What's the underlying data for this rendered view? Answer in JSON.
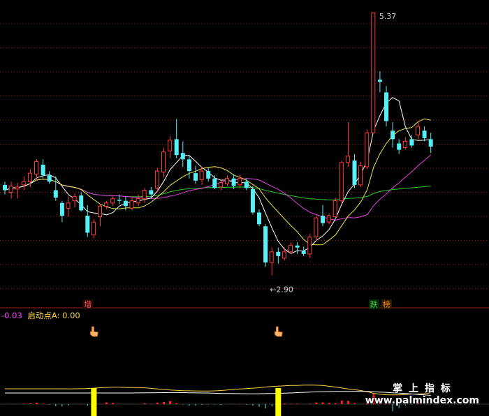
{
  "chart_data": {
    "type": "candlestick",
    "main": {
      "price_range": [
        2.6,
        5.45
      ],
      "high_label": "5.37",
      "high_price": 5.37,
      "low_label": "←2.90",
      "low_price": 2.9,
      "candles": [
        [
          3.75,
          3.7,
          3.78,
          3.66
        ],
        [
          3.68,
          3.74,
          3.78,
          3.62
        ],
        [
          3.71,
          3.73,
          3.77,
          3.62
        ],
        [
          3.75,
          3.78,
          3.83,
          3.7
        ],
        [
          3.78,
          3.86,
          3.9,
          3.73
        ],
        [
          3.85,
          3.97,
          3.99,
          3.79
        ],
        [
          3.94,
          3.84,
          3.99,
          3.81
        ],
        [
          3.84,
          3.78,
          3.88,
          3.76
        ],
        [
          3.7,
          3.63,
          3.83,
          3.6
        ],
        [
          3.58,
          3.46,
          3.6,
          3.4
        ],
        [
          3.53,
          3.58,
          3.64,
          3.45
        ],
        [
          3.6,
          3.64,
          3.67,
          3.54
        ],
        [
          3.65,
          3.51,
          3.68,
          3.5
        ],
        [
          3.46,
          3.3,
          3.56,
          3.26
        ],
        [
          3.28,
          3.4,
          3.43,
          3.25
        ],
        [
          3.45,
          3.55,
          3.57,
          3.36
        ],
        [
          3.55,
          3.58,
          3.6,
          3.52
        ],
        [
          3.58,
          3.62,
          3.65,
          3.55
        ],
        [
          3.61,
          3.6,
          3.66,
          3.57
        ],
        [
          3.6,
          3.55,
          3.64,
          3.51
        ],
        [
          3.53,
          3.6,
          3.63,
          3.51
        ],
        [
          3.58,
          3.62,
          3.66,
          3.55
        ],
        [
          3.62,
          3.7,
          3.72,
          3.58
        ],
        [
          3.7,
          3.66,
          3.73,
          3.62
        ],
        [
          3.72,
          3.88,
          3.91,
          3.68
        ],
        [
          3.87,
          4.06,
          4.1,
          3.82
        ],
        [
          4.07,
          4.17,
          4.21,
          4.0
        ],
        [
          4.18,
          4.03,
          4.37,
          4.0
        ],
        [
          4.05,
          3.99,
          4.16,
          3.92
        ],
        [
          3.99,
          3.88,
          4.02,
          3.81
        ],
        [
          3.86,
          3.79,
          3.93,
          3.76
        ],
        [
          3.8,
          3.88,
          3.92,
          3.75
        ],
        [
          3.88,
          3.81,
          3.91,
          3.78
        ],
        [
          3.81,
          3.72,
          3.84,
          3.71
        ],
        [
          3.73,
          3.77,
          3.81,
          3.7
        ],
        [
          3.76,
          3.81,
          3.84,
          3.74
        ],
        [
          3.81,
          3.74,
          3.85,
          3.71
        ],
        [
          3.75,
          3.81,
          3.84,
          3.72
        ],
        [
          3.78,
          3.72,
          3.81,
          3.7
        ],
        [
          3.71,
          3.49,
          3.74,
          3.47
        ],
        [
          3.49,
          3.38,
          3.52,
          3.36
        ],
        [
          3.36,
          3.02,
          3.38,
          2.98
        ],
        [
          3.02,
          3.12,
          3.16,
          2.9
        ],
        [
          3.12,
          3.08,
          3.16,
          3.01
        ],
        [
          3.06,
          3.12,
          3.16,
          3.04
        ],
        [
          3.12,
          3.18,
          3.21,
          3.1
        ],
        [
          3.18,
          3.16,
          3.21,
          3.1
        ],
        [
          3.13,
          3.1,
          3.17,
          3.08
        ],
        [
          3.1,
          3.26,
          3.29,
          3.06
        ],
        [
          3.26,
          3.44,
          3.47,
          3.22
        ],
        [
          3.46,
          3.39,
          3.56,
          3.36
        ],
        [
          3.4,
          3.46,
          3.48,
          3.38
        ],
        [
          3.45,
          3.6,
          3.63,
          3.43
        ],
        [
          3.6,
          3.96,
          3.98,
          3.58
        ],
        [
          3.96,
          4.02,
          4.34,
          3.92
        ],
        [
          3.98,
          3.75,
          4.04,
          3.72
        ],
        [
          3.75,
          3.93,
          3.97,
          3.73
        ],
        [
          3.92,
          4.24,
          4.27,
          3.9
        ],
        [
          4.24,
          5.37,
          5.37,
          4.55
        ],
        [
          4.74,
          4.72,
          4.82,
          4.62
        ],
        [
          4.62,
          4.35,
          4.68,
          4.3
        ],
        [
          4.26,
          4.18,
          4.34,
          4.1
        ],
        [
          4.14,
          4.08,
          4.18,
          4.04
        ],
        [
          4.1,
          4.16,
          4.2,
          4.08
        ],
        [
          4.18,
          4.12,
          4.22,
          4.1
        ],
        [
          4.22,
          4.3,
          4.35,
          4.18
        ],
        [
          4.26,
          4.19,
          4.3,
          4.16
        ],
        [
          4.18,
          4.11,
          4.24,
          4.05
        ]
      ],
      "ma_colors": {
        "ma5": "#ffffff",
        "ma10": "#e8e84a",
        "ma20": "#e040e0",
        "ma60": "#2ec82e"
      },
      "markers": [
        {
          "text": "增",
          "color": "#ff5a5a",
          "bg": "#2a0808",
          "index": 13
        },
        {
          "text": "跌",
          "color": "#3ccf3c",
          "bg": "#0a2a0a",
          "index": 58
        },
        {
          "text": "榜",
          "color": "#ff8c1a",
          "bg": "#2a1800",
          "index": 60
        }
      ]
    },
    "indicator": {
      "left_value": "-0.03",
      "series_label": "启动点A:",
      "series_value": "0.00",
      "label_color": "#ffd24a",
      "value_color": "#ff40ff",
      "signal_indices": [
        14,
        43
      ],
      "signal_color": "#ffff00",
      "line_color": "#ffd24a"
    },
    "watermark": {
      "line1": "掌 上 指 标",
      "line2": "www.palmindex.com"
    },
    "colors": {
      "up": "#ff3d3d",
      "down": "#54f1f8",
      "grid": "#9a1c1c",
      "background": "#000000"
    }
  }
}
